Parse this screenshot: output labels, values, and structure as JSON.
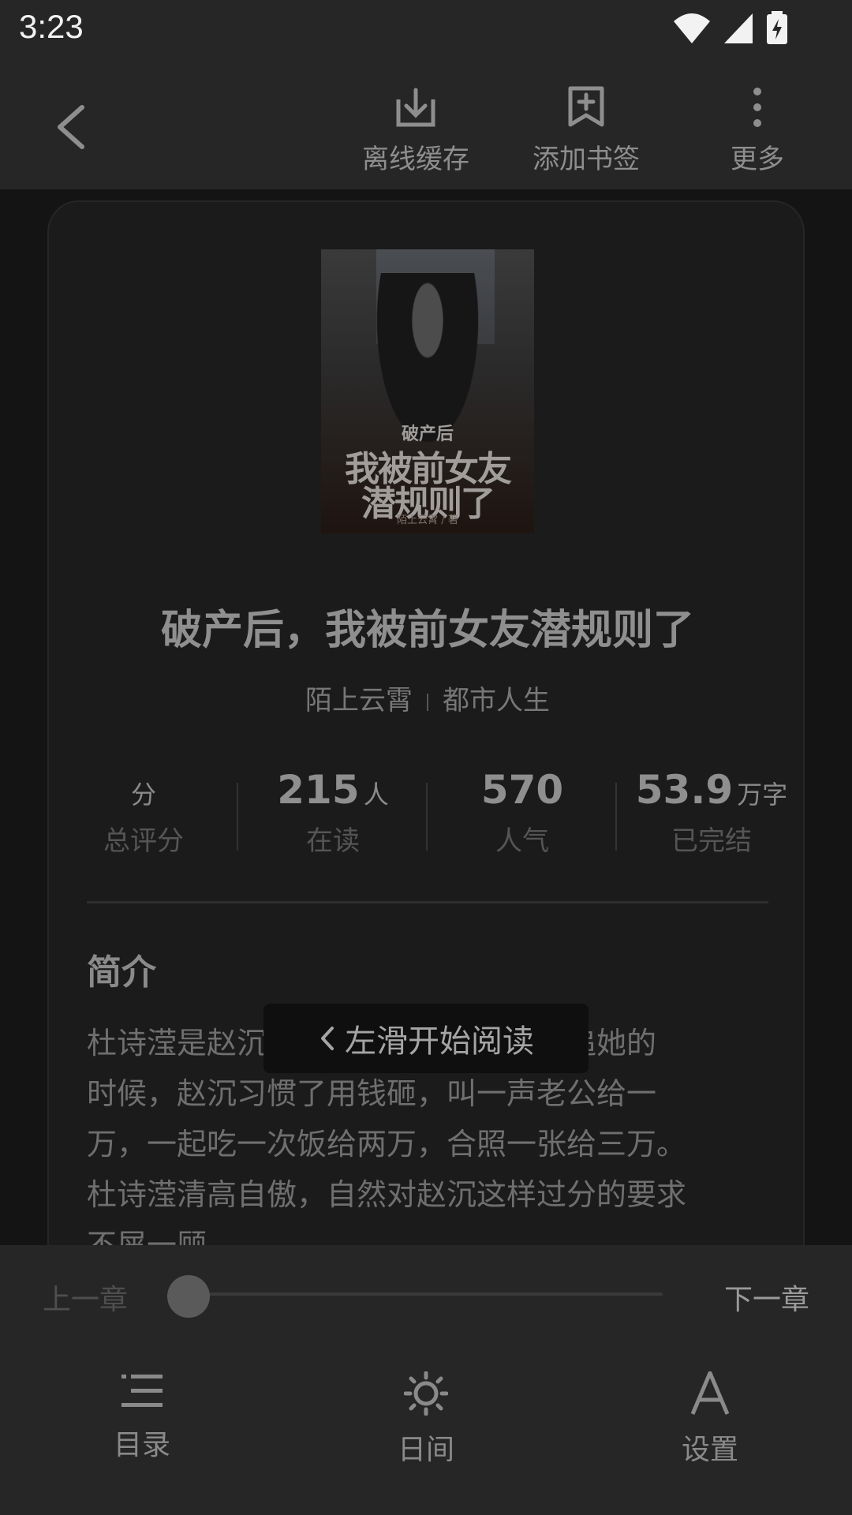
{
  "status_bar": {
    "time": "3:23",
    "icons": [
      "wifi-icon",
      "signal-icon",
      "battery-charging-icon"
    ]
  },
  "toolbar": {
    "back_icon": "chevron-left-icon",
    "offline_cache": "离线缓存",
    "add_bookmark": "添加书签",
    "more": "更多"
  },
  "book": {
    "cover": {
      "line1": "破产后",
      "line2": "我被前女友",
      "line3": "潜规则了",
      "author": "陌上云霄 / 著"
    },
    "title": "破产后，我被前女友潜规则了",
    "author": "陌上云霄",
    "category": "都市人生",
    "stats": [
      {
        "value": "",
        "unit": "分",
        "label": "总评分"
      },
      {
        "value": "215",
        "unit": "人",
        "label": "在读"
      },
      {
        "value": "570",
        "unit": "",
        "label": "人气"
      },
      {
        "value": "53.9",
        "unit": "万字",
        "label": "已完结"
      }
    ],
    "intro_heading": "简介",
    "intro_lines": [
      "杜诗滢是赵沉包养的情人之一，最初追她的",
      "时候，赵沉习惯了用钱砸，叫一声老公给一",
      "万，一起吃一次饭给两万，合照一张给三万。",
      "杜诗滢清高自傲，自然对赵沉这样过分的要求",
      "不屑一顾"
    ]
  },
  "toast": {
    "text": "左滑开始阅读"
  },
  "reader_controls": {
    "prev_chapter": "上一章",
    "next_chapter": "下一章",
    "progress": 0,
    "nav": {
      "toc": "目录",
      "day": "日间",
      "settings": "设置"
    }
  }
}
